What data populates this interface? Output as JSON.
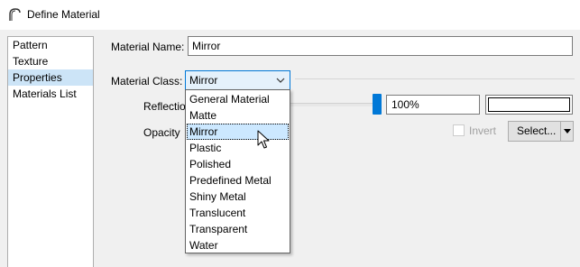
{
  "window": {
    "title": "Define Material",
    "icon": "arch-icon"
  },
  "sidebar": {
    "items": [
      {
        "label": "Pattern",
        "selected": false
      },
      {
        "label": "Texture",
        "selected": false
      },
      {
        "label": "Properties",
        "selected": true
      },
      {
        "label": "Materials List",
        "selected": false
      }
    ]
  },
  "form": {
    "material_name_label": "Material Name:",
    "material_name_value": "Mirror",
    "material_class_label": "Material Class:",
    "material_class_value": "Mirror",
    "reflectivity_label": "Reflectio",
    "reflectivity_value": "100%",
    "reflectivity_level": 1.0,
    "opacity_label": "Opacity",
    "invert_label": "Invert",
    "invert_checked": false,
    "select_button_label": "Select..."
  },
  "dropdown": {
    "open": true,
    "options": [
      "General Material",
      "Matte",
      "Mirror",
      "Plastic",
      "Polished",
      "Predefined Metal",
      "Shiny Metal",
      "Translucent",
      "Transparent",
      "Water"
    ],
    "hovered_index": 2
  },
  "colors": {
    "accent": "#0078d7",
    "selected_bg": "#cce4f7",
    "hover_bg": "#cce8ff",
    "disabled_text": "#a0a0a0"
  }
}
